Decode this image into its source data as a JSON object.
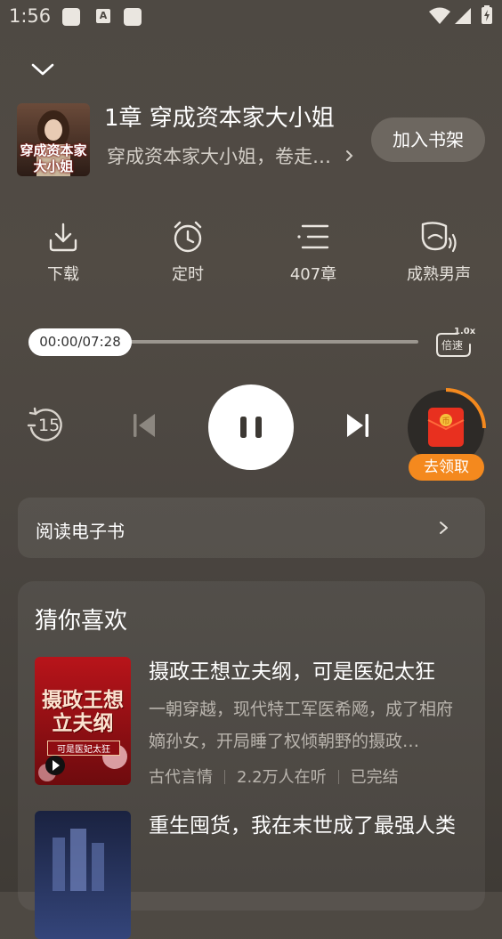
{
  "status_bar": {
    "time": "1:56"
  },
  "header": {
    "chapter_title": "第1章 穿成资本家大小姐",
    "book_subtitle": "穿成资本家大小姐，卷走…",
    "add_to_shelf": "加入书架",
    "cover_text": "穿成资本家大小姐"
  },
  "features": [
    {
      "label": "下载",
      "icon": "download-icon"
    },
    {
      "label": "定时",
      "icon": "alarm-clock-icon"
    },
    {
      "label": "407章",
      "icon": "list-icon"
    },
    {
      "label": "成熟男声",
      "icon": "voice-icon"
    }
  ],
  "player": {
    "time_display": "00:00/07:28",
    "progress": 0.0,
    "speed_value": "1.0x",
    "speed_label": "倍速",
    "replay_seconds": "15",
    "reward_button": "去领取"
  },
  "read_ebook": {
    "label": "阅读电子书"
  },
  "recommendations": {
    "title": "猜你喜欢",
    "items": [
      {
        "title": "摄政王想立夫纲，可是医妃太狂",
        "desc": "一朝穿越，现代特工军医希飏，成了相府嫡孙女，开局睡了权倾朝野的摄政…",
        "genre": "古代言情",
        "listeners": "2.2万人在听",
        "status": "已完结",
        "cover_text": "摄政王想立夫纲",
        "cover_sub": "可是医妃太狂"
      },
      {
        "title": "重生囤货，我在末世成了最强人类"
      }
    ]
  },
  "colors": {
    "accent_orange": "#f4891e",
    "background": "#4e4943",
    "white": "#ffffff"
  }
}
